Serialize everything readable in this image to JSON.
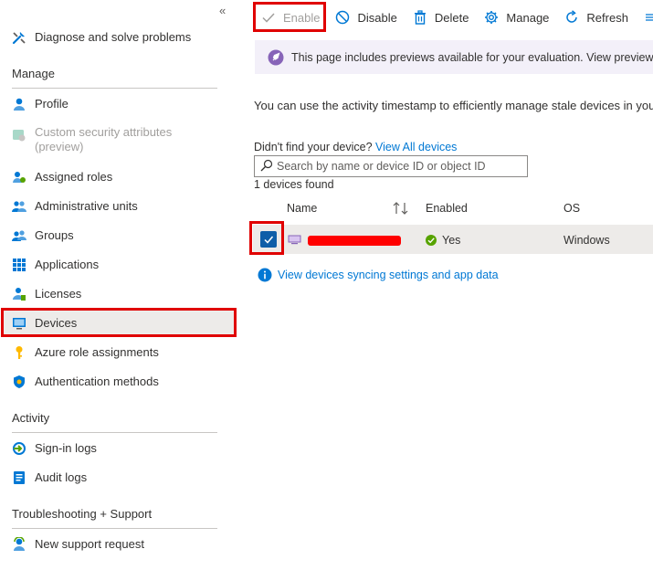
{
  "sidebar": {
    "collapse_glyph": "«",
    "top_item": {
      "label": "Diagnose and solve problems",
      "icon": "wrench-icon"
    },
    "sections": {
      "manage": "Manage",
      "activity": "Activity",
      "troubleshooting": "Troubleshooting + Support"
    },
    "manage_items": [
      {
        "label": "Profile",
        "icon": "profile-icon"
      },
      {
        "label": "Custom security attributes (preview)",
        "icon": "custom-attributes-icon"
      },
      {
        "label": "Assigned roles",
        "icon": "assigned-roles-icon"
      },
      {
        "label": "Administrative units",
        "icon": "admin-units-icon"
      },
      {
        "label": "Groups",
        "icon": "groups-icon"
      },
      {
        "label": "Applications",
        "icon": "applications-icon"
      },
      {
        "label": "Licenses",
        "icon": "licenses-icon"
      },
      {
        "label": "Devices",
        "icon": "devices-icon"
      },
      {
        "label": "Azure role assignments",
        "icon": "key-icon"
      },
      {
        "label": "Authentication methods",
        "icon": "shield-icon"
      }
    ],
    "activity_items": [
      {
        "label": "Sign-in logs",
        "icon": "sign-in-logs-icon"
      },
      {
        "label": "Audit logs",
        "icon": "audit-logs-icon"
      }
    ],
    "support_items": [
      {
        "label": "New support request",
        "icon": "support-icon"
      }
    ]
  },
  "toolbar": {
    "enable": "Enable",
    "disable": "Disable",
    "delete": "Delete",
    "manage": "Manage",
    "refresh": "Refresh"
  },
  "banner": {
    "text": "This page includes previews available for your evaluation. View previews"
  },
  "info_text": "You can use the activity timestamp to efficiently manage stale devices in your",
  "find": {
    "prompt": "Didn't find your device?",
    "link": "View All devices"
  },
  "search": {
    "placeholder": "Search by name or device ID or object ID",
    "value": ""
  },
  "devices_found": "1 devices found",
  "table": {
    "columns": {
      "name": "Name",
      "enabled": "Enabled",
      "os": "OS"
    },
    "rows": [
      {
        "name": "",
        "enabled": "Yes",
        "os": "Windows",
        "selected": true
      }
    ]
  },
  "sync_link": "View devices syncing settings and app data",
  "colors": {
    "accent": "#0078d4",
    "highlight_red": "#e00000",
    "selected_bg": "#edebe9",
    "banner_bg": "#f3f0f9",
    "success": "#57a300"
  }
}
